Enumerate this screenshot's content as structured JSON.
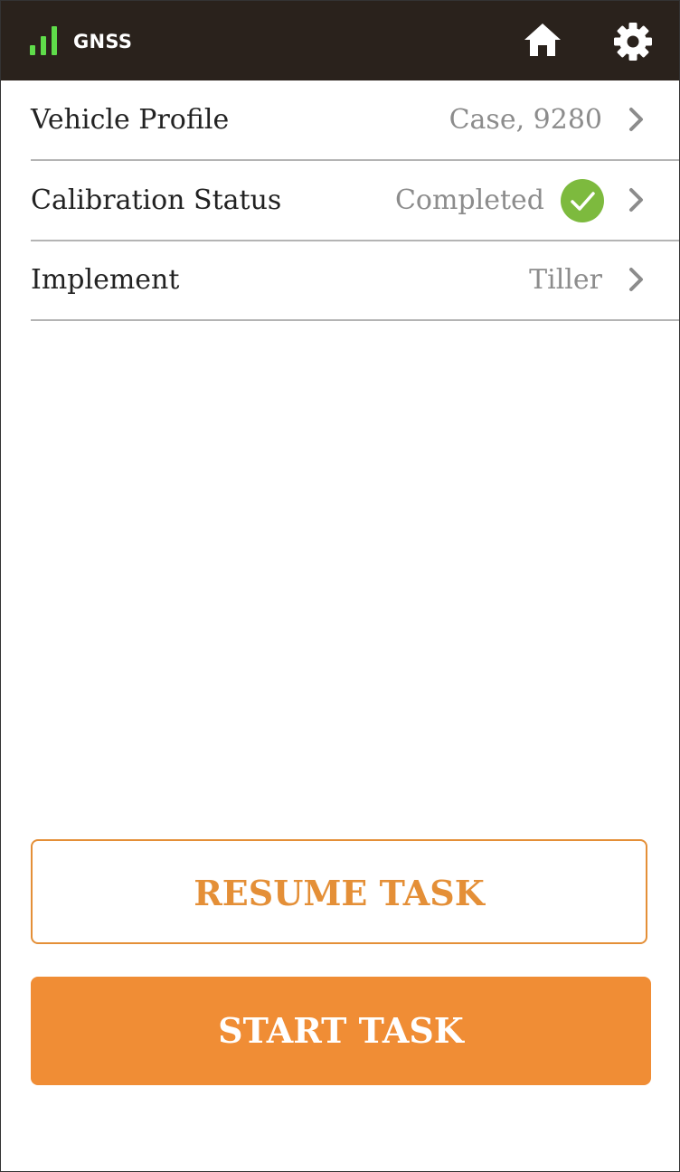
{
  "header": {
    "gnss_label": "GNSS",
    "signal_icon": "signal-bars-icon",
    "home_icon": "home-icon",
    "settings_icon": "gear-icon",
    "signal_bars_active": 3,
    "signal_color": "#5fdc4a"
  },
  "rows": [
    {
      "label": "Vehicle Profile",
      "value": "Case, 9280",
      "icon": "chevron-right-icon"
    },
    {
      "label": "Calibration Status",
      "value": "Completed",
      "status_icon": "check-circle-icon",
      "icon": "chevron-right-icon"
    },
    {
      "label": "Implement",
      "value": "Tiller",
      "icon": "chevron-right-icon"
    }
  ],
  "buttons": {
    "resume_label": "RESUME TASK",
    "start_label": "START TASK"
  },
  "colors": {
    "header_bg": "#2a221c",
    "accent": "#f08d35",
    "success": "#7dba3e",
    "chevron": "#8c8c8c"
  }
}
